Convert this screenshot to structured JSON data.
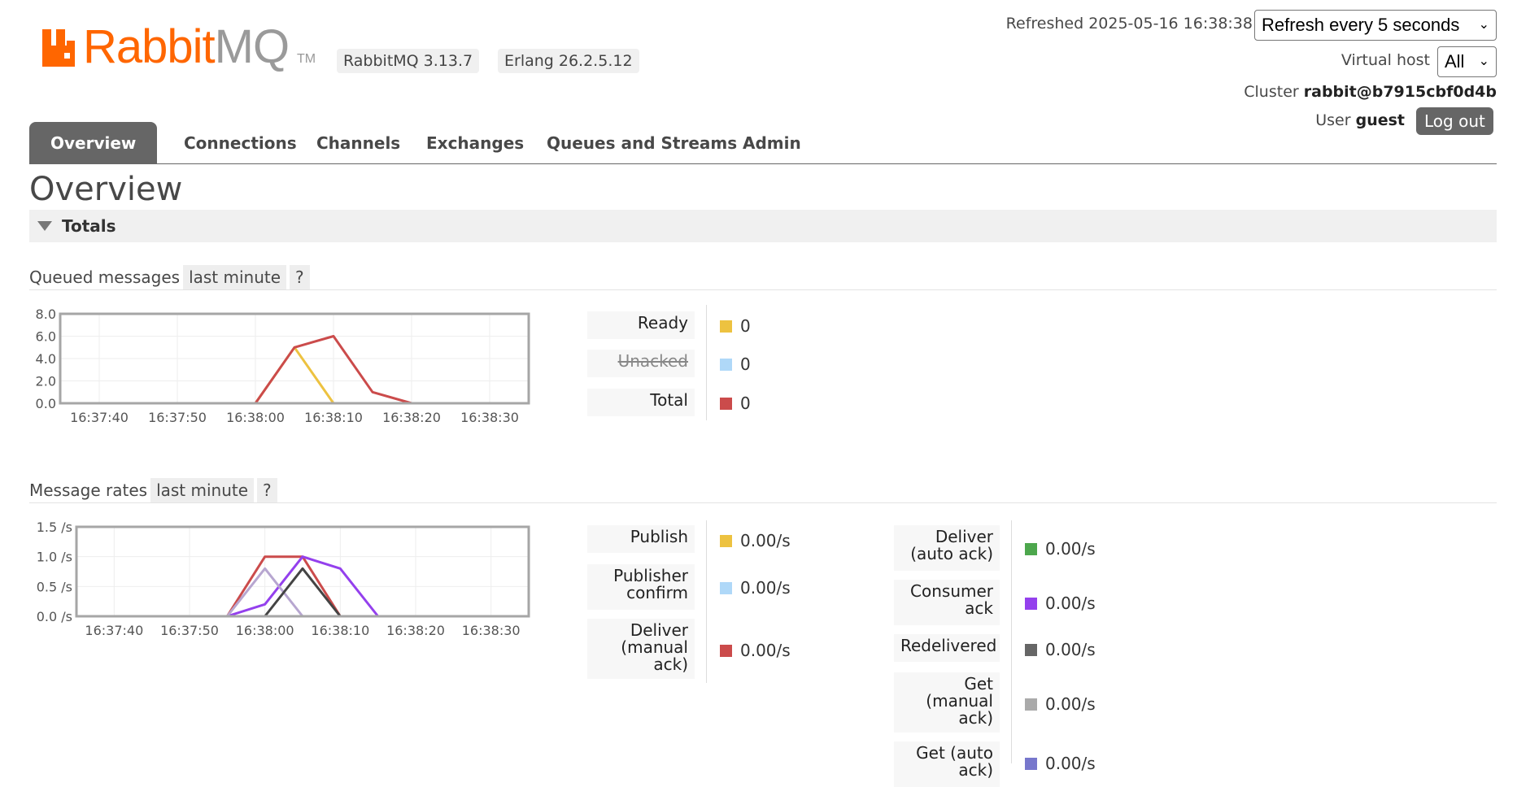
{
  "header": {
    "logo": {
      "part1": "Rabbit",
      "part2": "MQ",
      "tm": "TM"
    },
    "version_badge": "RabbitMQ 3.13.7",
    "erlang_badge": "Erlang 26.2.5.12",
    "refreshed": "Refreshed 2025-05-16 16:38:38",
    "refresh_select": "Refresh every 5 seconds",
    "vhost_label": "Virtual host",
    "vhost_select": "All",
    "cluster_label": "Cluster",
    "cluster_name": "rabbit@b7915cbf0d4b",
    "user_label": "User",
    "user_name": "guest",
    "logout": "Log out"
  },
  "tabs": [
    {
      "label": "Overview",
      "active": true
    },
    {
      "label": "Connections"
    },
    {
      "label": "Channels"
    },
    {
      "label": "Exchanges"
    },
    {
      "label": "Queues and Streams"
    },
    {
      "label": "Admin"
    }
  ],
  "page_title": "Overview",
  "totals_section": {
    "label": "Totals"
  },
  "queued": {
    "title": "Queued messages",
    "range": "last minute",
    "help": "?",
    "legend": [
      {
        "label": "Ready",
        "value": "0",
        "color": "#edc240"
      },
      {
        "label": "Unacked",
        "value": "0",
        "color": "#afd8f8",
        "disabled": true
      },
      {
        "label": "Total",
        "value": "0",
        "color": "#cb4b4b"
      }
    ]
  },
  "rates": {
    "title": "Message rates",
    "range": "last minute",
    "help": "?",
    "legend_left": [
      {
        "label": "Publish",
        "value": "0.00/s",
        "color": "#edc240"
      },
      {
        "label": "Publisher confirm",
        "value": "0.00/s",
        "color": "#afd8f8"
      },
      {
        "label": "Deliver (manual ack)",
        "value": "0.00/s",
        "color": "#cb4b4b"
      }
    ],
    "legend_right": [
      {
        "label": "Deliver (auto ack)",
        "value": "0.00/s",
        "color": "#4da74d"
      },
      {
        "label": "Consumer ack",
        "value": "0.00/s",
        "color": "#9440ed"
      },
      {
        "label": "Redelivered",
        "value": "0.00/s",
        "color": "#666666"
      },
      {
        "label": "Get (manual ack)",
        "value": "0.00/s",
        "color": "#aaaaaa"
      },
      {
        "label": "Get (auto ack)",
        "value": "0.00/s",
        "color": "#7777cc"
      }
    ]
  },
  "chart_data": [
    {
      "type": "line",
      "x": [
        "16:37:35",
        "16:37:40",
        "16:37:45",
        "16:37:50",
        "16:37:55",
        "16:38:00",
        "16:38:05",
        "16:38:10",
        "16:38:15",
        "16:38:20",
        "16:38:25",
        "16:38:30",
        "16:38:35"
      ],
      "xticks": [
        "16:37:40",
        "16:37:50",
        "16:38:00",
        "16:38:10",
        "16:38:20",
        "16:38:30"
      ],
      "yticks": [
        "0.0",
        "2.0",
        "4.0",
        "6.0",
        "8.0"
      ],
      "ylim": [
        0,
        8
      ],
      "series": [
        {
          "name": "Ready",
          "color": "#edc240",
          "values": [
            0,
            0,
            0,
            0,
            0,
            0,
            5,
            0,
            0,
            0,
            0,
            0,
            0
          ]
        },
        {
          "name": "Total",
          "color": "#cb4b4b",
          "values": [
            0,
            0,
            0,
            0,
            0,
            0,
            5,
            6,
            1,
            0,
            0,
            0,
            0
          ]
        }
      ]
    },
    {
      "type": "line",
      "x": [
        "16:37:35",
        "16:37:40",
        "16:37:45",
        "16:37:50",
        "16:37:55",
        "16:38:00",
        "16:38:05",
        "16:38:10",
        "16:38:15",
        "16:38:20",
        "16:38:25",
        "16:38:30",
        "16:38:35"
      ],
      "xticks": [
        "16:37:40",
        "16:37:50",
        "16:38:00",
        "16:38:10",
        "16:38:20",
        "16:38:30"
      ],
      "yticks": [
        "0.0 /s",
        "0.5 /s",
        "1.0 /s",
        "1.5 /s"
      ],
      "ylim": [
        0,
        1.5
      ],
      "series": [
        {
          "name": "Publish",
          "color": "#edc240",
          "values": [
            0,
            0,
            0,
            0,
            0,
            0,
            0,
            0,
            0,
            0,
            0,
            0,
            0
          ]
        },
        {
          "name": "Deliver (manual ack)",
          "color": "#cb4b4b",
          "values": [
            0,
            0,
            0,
            0,
            0,
            1.0,
            1.0,
            0,
            0,
            0,
            0,
            0,
            0
          ]
        },
        {
          "name": "Consumer ack",
          "color": "#9440ed",
          "values": [
            0,
            0,
            0,
            0,
            0,
            0.2,
            1.0,
            0.8,
            0,
            0,
            0,
            0,
            0
          ]
        },
        {
          "name": "Get (manual ack)",
          "color": "#b7a6d0",
          "values": [
            0,
            0,
            0,
            0,
            0,
            0.8,
            0,
            0,
            0,
            0,
            0,
            0,
            0
          ]
        },
        {
          "name": "Redelivered",
          "color": "#444444",
          "values": [
            0,
            0,
            0,
            0,
            0,
            0,
            0.8,
            0,
            0,
            0,
            0,
            0,
            0
          ]
        }
      ]
    }
  ]
}
